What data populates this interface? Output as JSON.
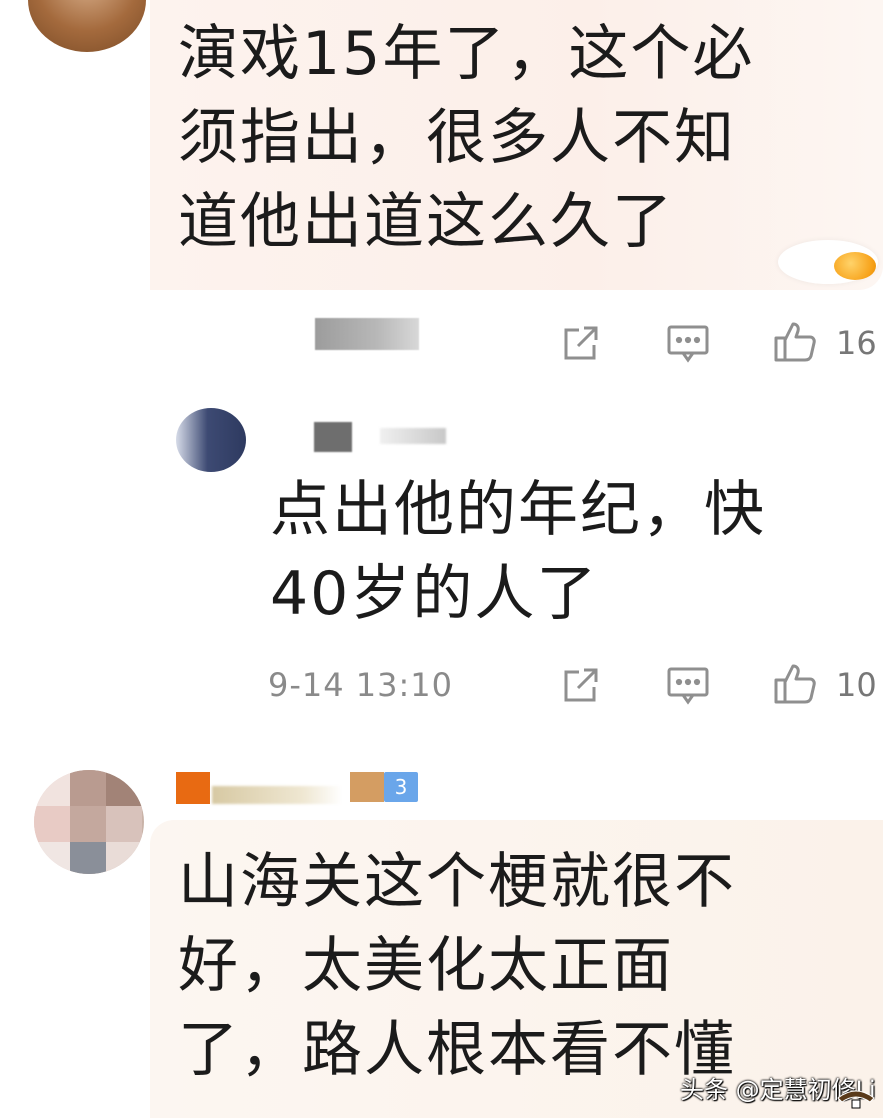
{
  "comments": [
    {
      "text": "演戏15年了，这个必\n须指出，很多人不知\n道他出道这么久了",
      "like_count": "16"
    },
    {
      "text": "点出他的年纪，快\n40岁的人了",
      "timestamp": "9-14 13:10",
      "like_count": "10"
    },
    {
      "text": "山海关这个梗就很不\n好，太美化太正面\n了，路人根本看不懂",
      "level_badge": "3"
    }
  ],
  "watermark": "头条 @定慧初修Li",
  "icons": {
    "share": "share-icon",
    "reply": "reply-icon",
    "like": "thumbs-up-icon"
  },
  "colors": {
    "bubble": "#fcefe9",
    "meta_text": "#8a8a8a",
    "icon": "#8f8f8f",
    "level_badge": "#6aa6ea"
  }
}
